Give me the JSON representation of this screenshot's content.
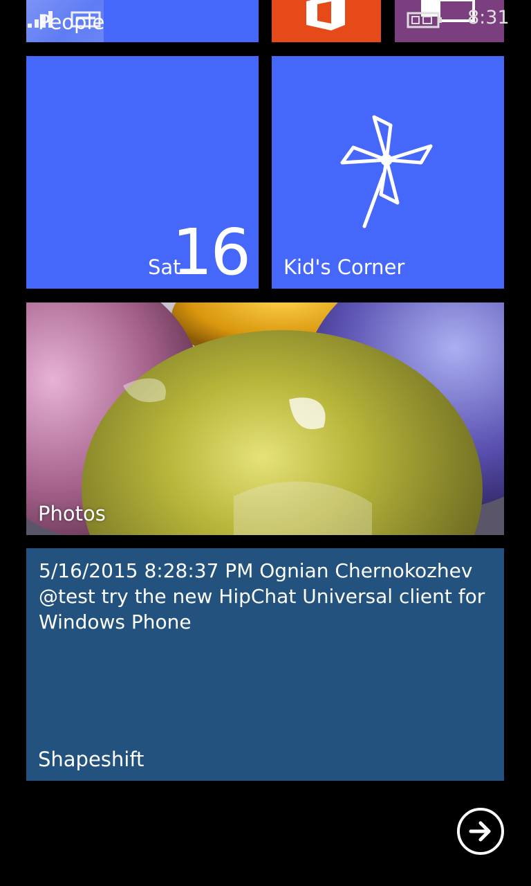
{
  "status_bar": {
    "clock": "8:31",
    "icons": [
      "signal-strength-icon",
      "wifi-icon",
      "battery-icon"
    ]
  },
  "colors": {
    "accent": "#4668FA",
    "office": "#E64A19",
    "messaging": "#7B3F7F",
    "shapeshift": "#23527E",
    "background": "#000000"
  },
  "tiles": {
    "people": {
      "label": "People"
    },
    "office": {
      "icon": "office-icon"
    },
    "messaging": {
      "icon": "messaging-icon"
    },
    "calendar": {
      "day": "Sat",
      "date": "16"
    },
    "kids_corner": {
      "label": "Kid's Corner",
      "icon": "pinwheel-icon"
    },
    "photos": {
      "label": "Photos"
    },
    "shapeshift": {
      "label": "Shapeshift",
      "message": "5/16/2015 8:28:37 PM Ognian Chernokozhev @test try the new HipChat Universal client for Windows Phone"
    }
  },
  "all_apps": {
    "icon": "arrow-right-circle-icon"
  }
}
